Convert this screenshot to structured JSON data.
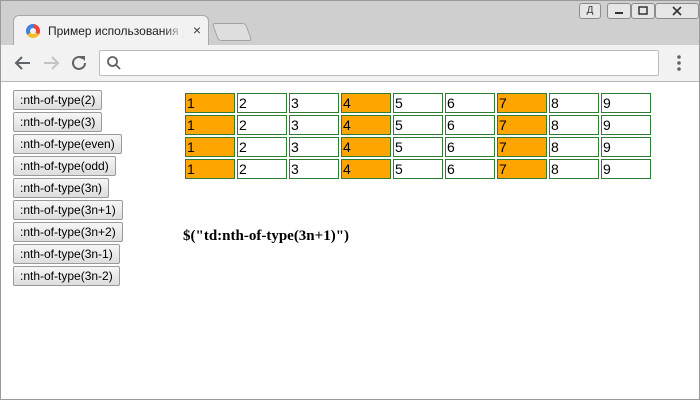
{
  "browser": {
    "tab_title": "Пример использования jQuery",
    "tab_close_glyph": "×",
    "profile_glyph": "Д",
    "omnibox_value": "",
    "omnibox_placeholder": ""
  },
  "page": {
    "buttons": [
      ":nth-of-type(2)",
      ":nth-of-type(3)",
      ":nth-of-type(even)",
      ":nth-of-type(odd)",
      ":nth-of-type(3n)",
      ":nth-of-type(3n+1)",
      ":nth-of-type(3n+2)",
      ":nth-of-type(3n-1)",
      ":nth-of-type(3n-2)"
    ],
    "table": {
      "rows": [
        [
          "1",
          "2",
          "3",
          "4",
          "5",
          "6",
          "7",
          "8",
          "9"
        ],
        [
          "1",
          "2",
          "3",
          "4",
          "5",
          "6",
          "7",
          "8",
          "9"
        ],
        [
          "1",
          "2",
          "3",
          "4",
          "5",
          "6",
          "7",
          "8",
          "9"
        ],
        [
          "1",
          "2",
          "3",
          "4",
          "5",
          "6",
          "7",
          "8",
          "9"
        ]
      ],
      "highlighted_columns": [
        1,
        4,
        7
      ],
      "highlight_color": "#ffa500",
      "border_color": "#2e7d32"
    },
    "selector_text": "$(\"td:nth-of-type(3n+1)\")"
  }
}
